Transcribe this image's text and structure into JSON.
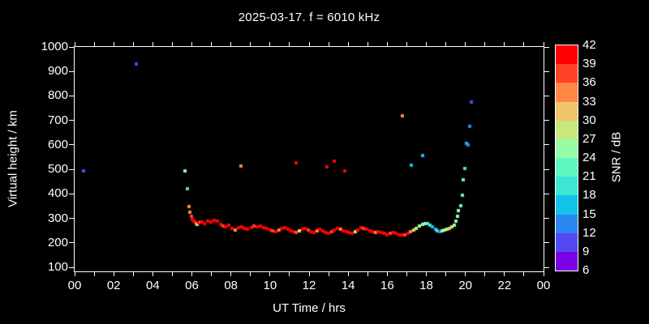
{
  "chart_data": {
    "type": "scatter",
    "title": "2025-03-17. f = 6010 kHz",
    "xlabel": "UT Time / hrs",
    "ylabel": "Virtual height / km",
    "xlim_hours": [
      0,
      24
    ],
    "ylim_km": [
      100,
      1000
    ],
    "grid": false,
    "background": "#000000",
    "text_color": "#ffffff",
    "x_tick_hours_step": 2,
    "x_minor_tick_hours_step": 1,
    "x_tick_labels": [
      "00",
      "02",
      "04",
      "06",
      "08",
      "10",
      "12",
      "14",
      "16",
      "18",
      "20",
      "22",
      "00"
    ],
    "y_tick_labels": [
      "100",
      "200",
      "300",
      "400",
      "500",
      "600",
      "700",
      "800",
      "900",
      "1000"
    ],
    "colorbar": {
      "title": "SNR / dB",
      "min_db": 6,
      "max_db": 42,
      "step_db": 3,
      "tick_labels": [
        "42",
        "39",
        "36",
        "33",
        "30",
        "27",
        "24",
        "21",
        "18",
        "15",
        "12",
        "9",
        "6"
      ],
      "segment_colors_top_to_bottom": [
        "#ff0000",
        "#ff4129",
        "#ff8746",
        "#f0c568",
        "#c8e87e",
        "#98fba5",
        "#5ff7c0",
        "#3be6d5",
        "#14c1e8",
        "#2a87f0",
        "#5249f2",
        "#7a00e8"
      ]
    },
    "series": [
      {
        "name": "ionospheric-echoes",
        "marker": "square",
        "marker_px": 4,
        "points_t_h_snr": [
          [
            0.46,
            495,
            10
          ],
          [
            3.14,
            930,
            10
          ],
          [
            5.65,
            495,
            25
          ],
          [
            5.77,
            420,
            20
          ],
          [
            5.86,
            348,
            34
          ],
          [
            5.91,
            325,
            34
          ],
          [
            5.98,
            308,
            37
          ],
          [
            6.03,
            296,
            40
          ],
          [
            6.1,
            289,
            40
          ],
          [
            6.16,
            285,
            40
          ],
          [
            6.22,
            280,
            37
          ],
          [
            6.28,
            274,
            28
          ],
          [
            6.36,
            282,
            40
          ],
          [
            6.45,
            285,
            37
          ],
          [
            6.52,
            285,
            40
          ],
          [
            6.65,
            279,
            40
          ],
          [
            6.81,
            289,
            40
          ],
          [
            6.98,
            285,
            40
          ],
          [
            7.14,
            292,
            40
          ],
          [
            7.31,
            289,
            40
          ],
          [
            7.48,
            275,
            40
          ],
          [
            7.6,
            269,
            37
          ],
          [
            7.74,
            265,
            40
          ],
          [
            7.89,
            272,
            40
          ],
          [
            8.05,
            259,
            40
          ],
          [
            8.22,
            252,
            34
          ],
          [
            8.39,
            262,
            40
          ],
          [
            8.51,
            515,
            34
          ],
          [
            8.55,
            265,
            40
          ],
          [
            8.68,
            259,
            40
          ],
          [
            8.85,
            256,
            40
          ],
          [
            9.05,
            262,
            40
          ],
          [
            9.18,
            269,
            37
          ],
          [
            9.34,
            265,
            40
          ],
          [
            9.51,
            269,
            40
          ],
          [
            9.68,
            262,
            40
          ],
          [
            9.85,
            259,
            40
          ],
          [
            10.0,
            252,
            40
          ],
          [
            10.15,
            248,
            37
          ],
          [
            10.3,
            245,
            40
          ],
          [
            10.45,
            252,
            34
          ],
          [
            10.6,
            258,
            40
          ],
          [
            10.75,
            262,
            40
          ],
          [
            10.9,
            255,
            40
          ],
          [
            11.05,
            248,
            40
          ],
          [
            11.2,
            244,
            40
          ],
          [
            11.34,
            528,
            40
          ],
          [
            11.35,
            241,
            37
          ],
          [
            11.5,
            248,
            28
          ],
          [
            11.65,
            254,
            40
          ],
          [
            11.8,
            258,
            40
          ],
          [
            11.95,
            251,
            37
          ],
          [
            12.1,
            245,
            40
          ],
          [
            12.25,
            241,
            40
          ],
          [
            12.4,
            248,
            34
          ],
          [
            12.55,
            254,
            40
          ],
          [
            12.7,
            248,
            40
          ],
          [
            12.85,
            241,
            40
          ],
          [
            12.91,
            510,
            40
          ],
          [
            13.0,
            238,
            40
          ],
          [
            13.15,
            244,
            37
          ],
          [
            13.29,
            532,
            41
          ],
          [
            13.3,
            251,
            40
          ],
          [
            13.45,
            258,
            40
          ],
          [
            13.6,
            254,
            34
          ],
          [
            13.75,
            248,
            40
          ],
          [
            13.83,
            495,
            40
          ],
          [
            13.9,
            244,
            40
          ],
          [
            14.05,
            241,
            40
          ],
          [
            14.2,
            238,
            40
          ],
          [
            14.35,
            244,
            28
          ],
          [
            14.5,
            251,
            40
          ],
          [
            14.65,
            261,
            40
          ],
          [
            14.8,
            258,
            37
          ],
          [
            14.95,
            254,
            40
          ],
          [
            15.1,
            248,
            40
          ],
          [
            15.25,
            244,
            40
          ],
          [
            15.4,
            241,
            34
          ],
          [
            15.55,
            244,
            40
          ],
          [
            15.7,
            241,
            40
          ],
          [
            15.85,
            238,
            40
          ],
          [
            16.0,
            234,
            40
          ],
          [
            16.15,
            238,
            37
          ],
          [
            16.3,
            241,
            40
          ],
          [
            16.45,
            238,
            40
          ],
          [
            16.6,
            234,
            40
          ],
          [
            16.75,
            231,
            40
          ],
          [
            16.78,
            720,
            33
          ],
          [
            16.9,
            234,
            37
          ],
          [
            17.05,
            238,
            40
          ],
          [
            17.2,
            244,
            34
          ],
          [
            17.23,
            517,
            16
          ],
          [
            17.35,
            251,
            31
          ],
          [
            17.5,
            258,
            28
          ],
          [
            17.65,
            268,
            26
          ],
          [
            17.8,
            275,
            25
          ],
          [
            17.8,
            557,
            17
          ],
          [
            17.95,
            280,
            26
          ],
          [
            18.08,
            278,
            22
          ],
          [
            18.2,
            271,
            19
          ],
          [
            18.33,
            264,
            16
          ],
          [
            18.46,
            256,
            17
          ],
          [
            18.58,
            250,
            19
          ],
          [
            18.7,
            246,
            13
          ],
          [
            18.82,
            248,
            25
          ],
          [
            18.94,
            251,
            28
          ],
          [
            19.06,
            254,
            25
          ],
          [
            19.18,
            259,
            30
          ],
          [
            19.3,
            264,
            27
          ],
          [
            19.42,
            272,
            25
          ],
          [
            19.5,
            288,
            25
          ],
          [
            19.58,
            310,
            24
          ],
          [
            19.66,
            332,
            25
          ],
          [
            19.76,
            352,
            23
          ],
          [
            19.84,
            396,
            22
          ],
          [
            19.9,
            458,
            21
          ],
          [
            19.98,
            505,
            19
          ],
          [
            20.06,
            605,
            16
          ],
          [
            20.14,
            598,
            13
          ],
          [
            20.22,
            675,
            13
          ],
          [
            20.31,
            775,
            11
          ]
        ]
      }
    ]
  }
}
